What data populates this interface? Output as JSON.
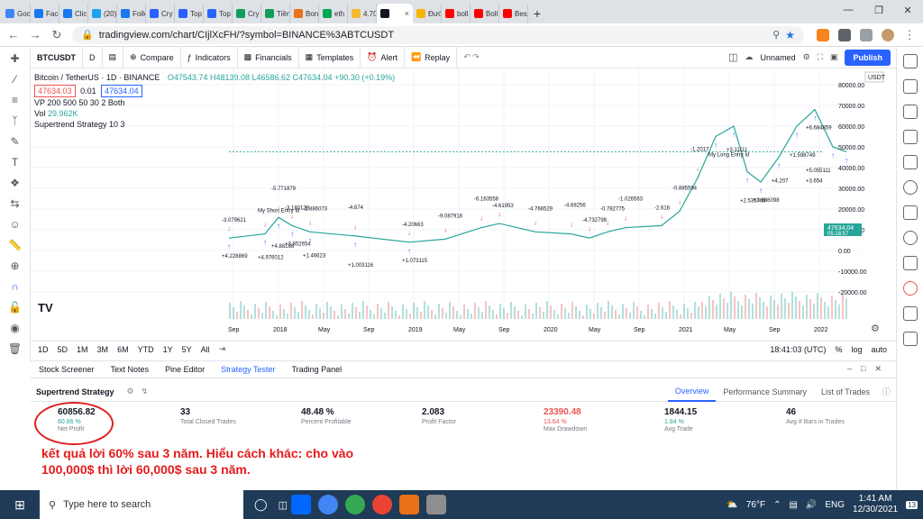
{
  "browser": {
    "tabs": [
      {
        "label": "Goc",
        "color": "#4285f4"
      },
      {
        "label": "Face",
        "color": "#1877f2"
      },
      {
        "label": "Clic",
        "color": "#1877f2"
      },
      {
        "label": "(20)",
        "color": "#1da1f2"
      },
      {
        "label": "Follo",
        "color": "#1877f2"
      },
      {
        "label": "Cry",
        "color": "#2962ff"
      },
      {
        "label": "Top",
        "color": "#2962ff"
      },
      {
        "label": "Top",
        "color": "#2962ff"
      },
      {
        "label": "Cry",
        "color": "#0f9d58"
      },
      {
        "label": "Tiền",
        "color": "#0f9d58"
      },
      {
        "label": "Bon",
        "color": "#e8711a"
      },
      {
        "label": "eth",
        "color": "#00a651"
      },
      {
        "label": "4.70",
        "color": "#f3ba2f"
      },
      {
        "label": "",
        "color": "#131722"
      },
      {
        "label": "Đườ",
        "color": "#f4b400"
      },
      {
        "label": "boll",
        "color": "#ff0000"
      },
      {
        "label": "Boll",
        "color": "#ff0000"
      },
      {
        "label": "Bes",
        "color": "#ff0000"
      }
    ],
    "url": "tradingview.com/chart/CIjlXcFH/?symbol=BINANCE%3ABTCUSDT"
  },
  "toolbar": {
    "symbol": "BTCUSDT",
    "interval": "D",
    "compare": "Compare",
    "indicators": "Indicators",
    "financials": "Financials",
    "templates": "Templates",
    "alert": "Alert",
    "replay": "Replay",
    "layout": "Unnamed",
    "publish": "Publish"
  },
  "legend": {
    "title": "Bitcoin / TetherUS · 1D · BINANCE",
    "ohlc": "O47543.74 H48139.08 L46586.62 C47634.04 +90.30 (+0.19%)",
    "bid": "47634.03",
    "spread": "0.01",
    "ask": "47634.04",
    "vp": "VP 200 500 50 30 2 Both",
    "vol": "Vol",
    "vol_value": "29.962K",
    "strategy": "Supertrend Strategy 10 3"
  },
  "price_axis": {
    "currency": "USDT",
    "ticks": [
      "80000.00",
      "70000.00",
      "60000.00",
      "50000.00",
      "40000.00",
      "30000.00",
      "20000.00",
      "10000.00",
      "0.00",
      "-10000.00",
      "-20000.00"
    ],
    "last_price": "47634.04",
    "countdown": "05:18:57"
  },
  "time_axis": {
    "ticks": [
      "Sep",
      "2018",
      "May",
      "Sep",
      "2019",
      "May",
      "Sep",
      "2020",
      "May",
      "Sep",
      "2021",
      "May",
      "Sep",
      "2022"
    ]
  },
  "chart_labels": {
    "signals": [
      "-3.079621",
      "My Short Entry Id",
      "-5.771879",
      "-3.180128",
      "-1.886073",
      "-4.674",
      "-4.20663",
      "-9.087918",
      "-6.163558",
      "-4.61953",
      "-4.766529",
      "-4.68256",
      "-4.732798",
      "-0.782775",
      "-1.026563",
      "-2.616",
      "-0.885594",
      "-1.2017",
      "My Long Entry Id",
      "+3.11111",
      "+2.535766",
      "+3.686098",
      "+4.207",
      "+1.598749",
      "+6.684859",
      "+5.055111",
      "+3.654",
      "+4.228869",
      "+4.976012",
      "+4.88198",
      "+3.852654",
      "+1.46623",
      "+1.003116",
      "+1.073115"
    ]
  },
  "bottom_bar": {
    "ranges": [
      "1D",
      "5D",
      "1M",
      "3M",
      "6M",
      "YTD",
      "1Y",
      "5Y",
      "All"
    ],
    "time": "18:41:03 (UTC)",
    "pct": "%",
    "log": "log",
    "auto": "auto"
  },
  "panel_tabs": [
    "Stock Screener",
    "Text Notes",
    "Pine Editor",
    "Strategy Tester",
    "Trading Panel"
  ],
  "strategy": {
    "name": "Supertrend Strategy",
    "tabs": [
      "Overview",
      "Performance Summary",
      "List of Trades"
    ],
    "metrics": [
      {
        "value": "60856.82",
        "sub": "60.86 %",
        "label": "Net Profit"
      },
      {
        "value": "33",
        "sub": "",
        "label": "Total Closed Trades"
      },
      {
        "value": "48.48 %",
        "sub": "",
        "label": "Percent Profitable"
      },
      {
        "value": "2.083",
        "sub": "",
        "label": "Profit Factor"
      },
      {
        "value": "23390.48",
        "sub": "13.64 %",
        "label": "Max Drawdown"
      },
      {
        "value": "1844.15",
        "sub": "1.84 %",
        "label": "Avg Trade"
      },
      {
        "value": "46",
        "sub": "",
        "label": "Avg # Bars in Trades"
      }
    ]
  },
  "annotation": "kết quả lời 60% sau 3 năm. Hiểu cách khác: cho vào 100,000$ thì lời 60,000$ sau 3 năm.",
  "taskbar": {
    "search_placeholder": "Type here to search",
    "weather": "76°F",
    "lang": "ENG",
    "time": "1:41 AM",
    "date": "12/30/2021",
    "notif": "13"
  },
  "colors": {
    "accent": "#2962ff",
    "up": "#26a69a",
    "down": "#ef5350",
    "annotation": "#e31b1b"
  }
}
